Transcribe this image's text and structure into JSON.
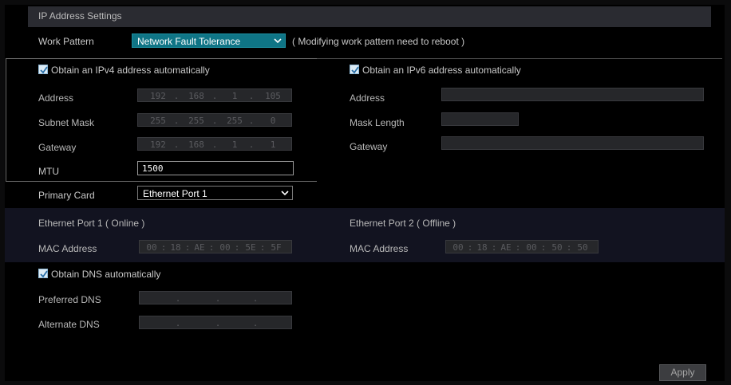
{
  "title": "IP Address Settings",
  "work_pattern": {
    "label": "Work Pattern",
    "value": "Network Fault Tolerance",
    "note": "( Modifying work pattern need to reboot )"
  },
  "ipv4": {
    "checkbox_label": "Obtain an IPv4 address automatically",
    "checked": true,
    "address_label": "Address",
    "address": [
      "192",
      "168",
      "1",
      "105"
    ],
    "subnet_label": "Subnet Mask",
    "subnet": [
      "255",
      "255",
      "255",
      "0"
    ],
    "gateway_label": "Gateway",
    "gateway": [
      "192",
      "168",
      "1",
      "1"
    ],
    "mtu_label": "MTU",
    "mtu": "1500"
  },
  "ipv6": {
    "checkbox_label": "Obtain an IPv6 address automatically",
    "checked": true,
    "address_label": "Address",
    "mask_label": "Mask Length",
    "gateway_label": "Gateway"
  },
  "primary_card": {
    "label": "Primary Card",
    "value": "Ethernet Port 1"
  },
  "ports": {
    "port1_title": "Ethernet Port 1 ( Online )",
    "port1_mac_label": "MAC Address",
    "port1_mac": [
      "00",
      "18",
      "AE",
      "00",
      "5E",
      "5F"
    ],
    "port2_title": "Ethernet Port 2 ( Offline )",
    "port2_mac_label": "MAC Address",
    "port2_mac": [
      "00",
      "18",
      "AE",
      "00",
      "50",
      "50"
    ]
  },
  "dns": {
    "checkbox_label": "Obtain DNS automatically",
    "checked": true,
    "preferred_label": "Preferred DNS",
    "alternate_label": "Alternate DNS"
  },
  "apply_label": "Apply"
}
